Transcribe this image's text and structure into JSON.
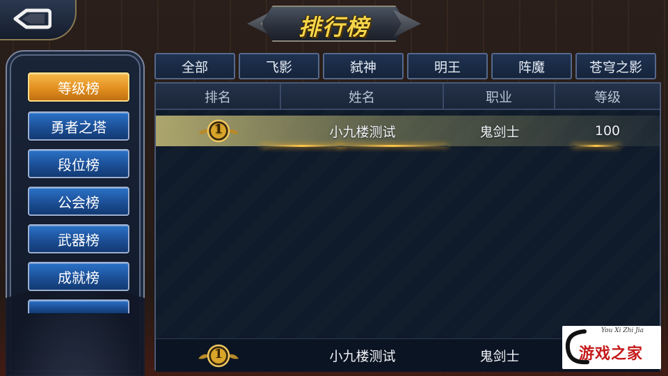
{
  "title": "排行榜",
  "sidebar": {
    "items": [
      {
        "label": "等级榜",
        "active": true
      },
      {
        "label": "勇者之塔",
        "active": false
      },
      {
        "label": "段位榜",
        "active": false
      },
      {
        "label": "公会榜",
        "active": false
      },
      {
        "label": "武器榜",
        "active": false
      },
      {
        "label": "成就榜",
        "active": false
      }
    ]
  },
  "tabs": [
    "全部",
    "飞影",
    "弑神",
    "明王",
    "阵魔",
    "苍穹之影"
  ],
  "table": {
    "columns": [
      "排名",
      "姓名",
      "职业",
      "等级"
    ],
    "rows": [
      {
        "rank": "1",
        "name": "小九楼测试",
        "job": "鬼剑士",
        "level": "100"
      }
    ]
  },
  "self_row": {
    "rank": "1",
    "name": "小九楼测试",
    "job": "鬼剑士"
  },
  "logo": {
    "script": "You Xi Zhi Jia",
    "name": "游戏之家"
  },
  "colors": {
    "active_button": "#e29020",
    "button_blue": "#1c4f96",
    "title_gold": "#f6d64a",
    "medal_gold": "#d9a52a"
  },
  "icons": {
    "back": "back-arrow-icon",
    "medal": "rank-medal-icon"
  }
}
